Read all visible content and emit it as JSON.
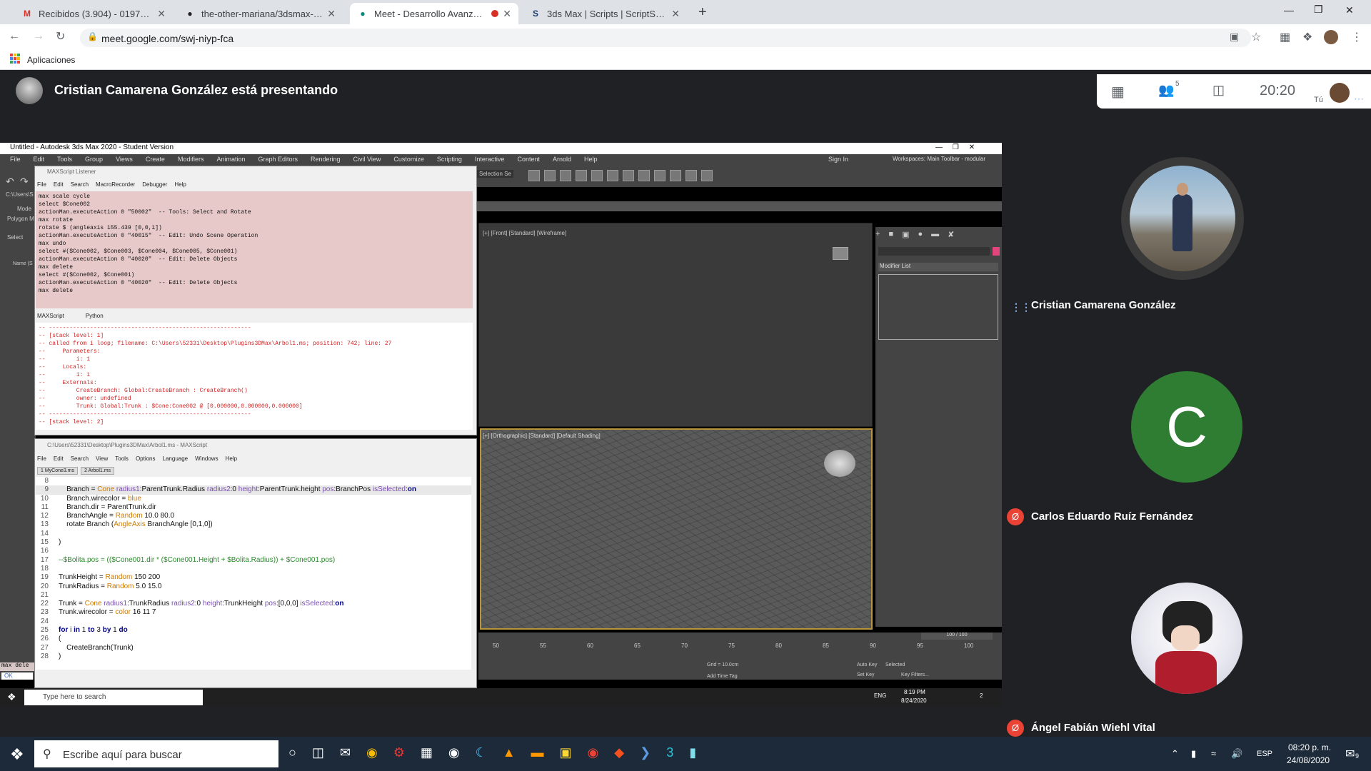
{
  "browser": {
    "tabs": [
      {
        "title": "Recibidos (3.904) - 0197495@up",
        "icon": "gmail-icon",
        "fav": "M",
        "favcolor": "#d93025"
      },
      {
        "title": "the-other-mariana/3dsmax-plug",
        "icon": "github-icon",
        "fav": "●",
        "favcolor": "#202124"
      },
      {
        "title": "Meet - Desarrollo Avanzado",
        "icon": "meet-icon",
        "fav": "●",
        "favcolor": "#00897b",
        "active": true
      },
      {
        "title": "3ds Max | Scripts | ScriptSpot",
        "icon": "scriptspot-icon",
        "fav": "S",
        "favcolor": "#1a3c6e"
      }
    ],
    "url": "meet.google.com/swj-niyp-fca",
    "bookmarks_label": "Aplicaciones"
  },
  "meet": {
    "presenting_text": "Cristian Camarena González está presentando",
    "clock": "20:20",
    "people_badge": "5",
    "self_label": "Tú",
    "participants": [
      {
        "name": "Cristian Camarena González",
        "kind": "photo"
      },
      {
        "name": "Carlos Eduardo Ruíz Fernández",
        "initial": "C",
        "color": "#2e7d32",
        "muted": true
      },
      {
        "name": "Ángel Fabián Wiehl Vital",
        "kind": "anime",
        "muted": true
      }
    ]
  },
  "max": {
    "title": "Untitled - Autodesk 3ds Max 2020 - Student Version",
    "menu": [
      "File",
      "Edit",
      "Tools",
      "Group",
      "Views",
      "Create",
      "Modifiers",
      "Animation",
      "Graph Editors",
      "Rendering",
      "Civil View",
      "Customize",
      "Scripting",
      "Interactive",
      "Content",
      "Arnold",
      "Help"
    ],
    "sign_in": "Sign In",
    "workspace": "Workspaces: Main Toolbar - modular",
    "selection_set": "Selection Se",
    "vp_front_label": "[+] [Front] [Standard] [Wireframe]",
    "vp_persp_label": "[+] [Orthographic] [Standard] [Default Shading]",
    "modifier_list": "Modifier List",
    "frame": "100 / 100",
    "ticks": [
      "50",
      "55",
      "60",
      "65",
      "70",
      "75",
      "80",
      "85",
      "90",
      "95",
      "100"
    ],
    "grid": "Grid = 10.0cm",
    "add_time_tag": "Add Time Tag",
    "auto_key": "Auto Key",
    "set_key": "Set Key",
    "selected": "Selected",
    "key_filters": "Key Filters...",
    "left_select": "Select",
    "left_mode": "Mode",
    "left_polygon": "Polygon M",
    "left_path": "C:\\Users\\S",
    "left_name": "Name (S",
    "left_status": "max dele",
    "left_ok": "OK",
    "listener_title": "MAXScript Listener",
    "listener_menu": [
      "File",
      "Edit",
      "Search",
      "MacroRecorder",
      "Debugger",
      "Help"
    ],
    "listener_tabs": [
      "MAXScript",
      "Python"
    ],
    "listener_out": "max scale cycle\nselect $Cone002\nactionMan.executeAction 0 \"50002\"  -- Tools: Select and Rotate\nmax rotate\nrotate $ (angleaxis 155.439 [0,0,1])\nactionMan.executeAction 0 \"40015\"  -- Edit: Undo Scene Operation\nmax undo\nselect #($Cone002, $Cone003, $Cone004, $Cone005, $Cone001)\nactionMan.executeAction 0 \"40020\"  -- Edit: Delete Objects\nmax delete\nselect #($Cone002, $Cone001)\nactionMan.executeAction 0 \"40020\"  -- Edit: Delete Objects\nmax delete",
    "listener_err": "-- -----------------------------------------------------------\n-- [stack level: 1]\n-- called from i loop; filename: C:\\Users\\52331\\Desktop\\Plugins3DMax\\Arbol1.ms; position: 742; line: 27\n--     Parameters:\n--         i: 1\n--     Locals:\n--         i: 1\n--     Externals:\n--         CreateBranch: Global:CreateBranch : CreateBranch()\n--         owner: undefined\n--         Trunk: Global:Trunk : $Cone:Cone002 @ [0.000000,0.000000,0.000000]\n-- -----------------------------------------------------------\n-- [stack level: 2]",
    "editor_title": "C:\\Users\\52331\\Desktop\\Plugins3DMax\\Arbol1.ms - MAXScript",
    "editor_menu": [
      "File",
      "Edit",
      "Search",
      "View",
      "Tools",
      "Options",
      "Language",
      "Windows",
      "Help"
    ],
    "editor_tabs": [
      "1 MyCone3.ms",
      "2 Arbol1.ms"
    ],
    "code": [
      {
        "n": "8",
        "t": ""
      },
      {
        "n": "9",
        "t": "    Branch = Cone radius1:ParentTrunk.Radius radius2:0 height:ParentTrunk.height pos:BranchPos isSelected:on"
      },
      {
        "n": "10",
        "t": "    Branch.wirecolor = blue"
      },
      {
        "n": "11",
        "t": "    Branch.dir = ParentTrunk.dir"
      },
      {
        "n": "12",
        "t": "    BranchAngle = Random 10.0 80.0"
      },
      {
        "n": "13",
        "t": "    rotate Branch (AngleAxis BranchAngle [0,1,0])"
      },
      {
        "n": "14",
        "t": ""
      },
      {
        "n": "15",
        "t": ")"
      },
      {
        "n": "16",
        "t": ""
      },
      {
        "n": "17",
        "t": "--$Bolita.pos = (($Cone001.dir * ($Cone001.Height + $Bolita.Radius)) + $Cone001.pos)"
      },
      {
        "n": "18",
        "t": ""
      },
      {
        "n": "19",
        "t": "TrunkHeight = Random 150 200"
      },
      {
        "n": "20",
        "t": "TrunkRadius = Random 5.0 15.0"
      },
      {
        "n": "21",
        "t": ""
      },
      {
        "n": "22",
        "t": "Trunk = Cone radius1:TrunkRadius radius2:0 height:TrunkHeight pos:[0,0,0] isSelected:on"
      },
      {
        "n": "23",
        "t": "Trunk.wirecolor = color 16 11 7"
      },
      {
        "n": "24",
        "t": ""
      },
      {
        "n": "25",
        "t": "for i in 1 to 3 by 1 do"
      },
      {
        "n": "26",
        "t": "("
      },
      {
        "n": "27",
        "t": "    CreateBranch(Trunk)"
      },
      {
        "n": "28",
        "t": ")"
      }
    ],
    "taskbar_search": "Type here to search",
    "taskbar_lang": "ENG",
    "taskbar_time": "8:19 PM",
    "taskbar_date": "8/24/2020",
    "taskbar_notif": "2"
  },
  "host_taskbar": {
    "search": "Escribe aquí para buscar",
    "lang": "ESP",
    "time": "08:20 p. m.",
    "date": "24/08/2020",
    "notif": "9"
  }
}
